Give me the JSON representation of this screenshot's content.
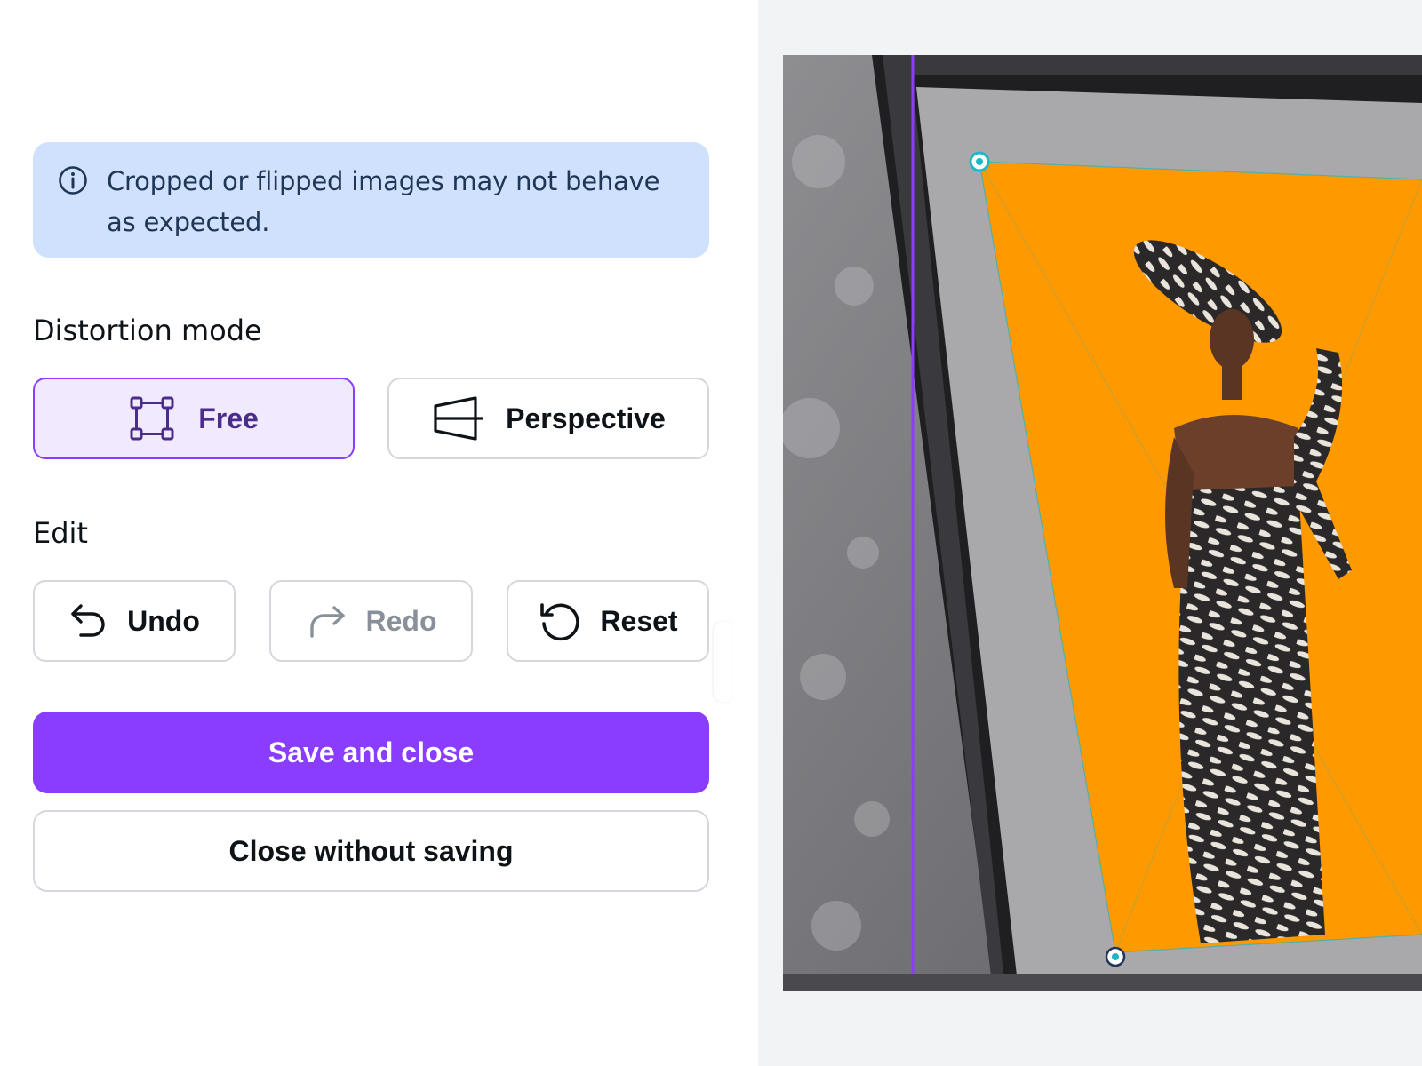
{
  "info": {
    "icon": "info-icon",
    "message": "Cropped or flipped images may not behave as expected."
  },
  "distortion": {
    "label": "Distortion mode",
    "free_label": "Free",
    "perspective_label": "Perspective",
    "selected": "Free"
  },
  "edit": {
    "label": "Edit",
    "undo_label": "Undo",
    "redo_label": "Redo",
    "reset_label": "Reset"
  },
  "actions": {
    "save_label": "Save and close",
    "close_label": "Close without saving"
  },
  "colors": {
    "accent": "#8b3dff",
    "info_bg": "#cfe1fc",
    "handle": "#1fb6c8",
    "image_bg": "#ff9900"
  }
}
